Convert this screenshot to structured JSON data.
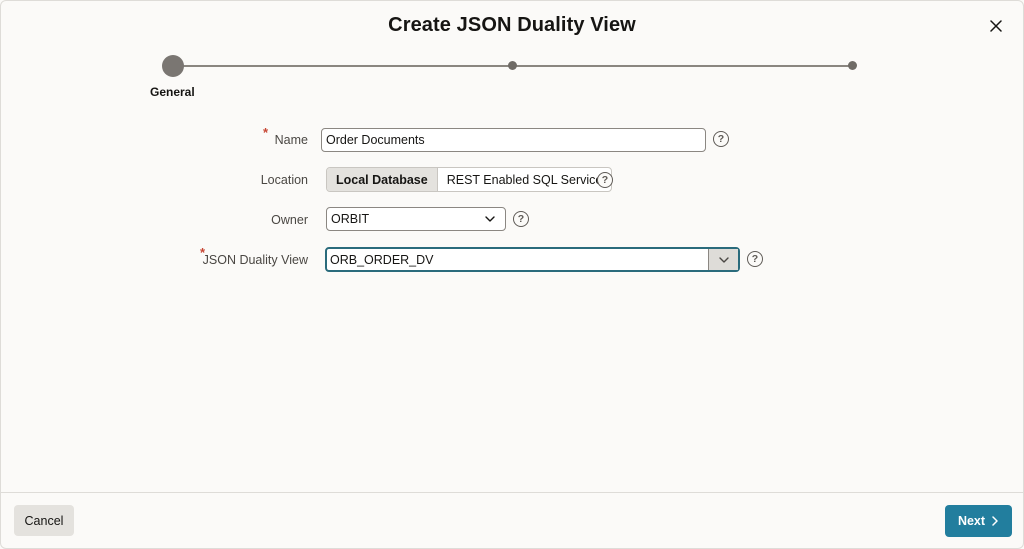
{
  "dialog": {
    "title": "Create JSON Duality View",
    "close_icon": "close-icon"
  },
  "wizard": {
    "steps": [
      {
        "label": "General",
        "state": "active"
      },
      {
        "label": "",
        "state": "pending"
      },
      {
        "label": "",
        "state": "pending"
      }
    ]
  },
  "form": {
    "name": {
      "label": "Name",
      "required": true,
      "value": "Order Documents"
    },
    "location": {
      "label": "Location",
      "options": [
        "Local Database",
        "REST Enabled SQL Service"
      ],
      "selected": "Local Database"
    },
    "owner": {
      "label": "Owner",
      "value": "ORBIT"
    },
    "duality_view": {
      "label": "JSON Duality View",
      "required": true,
      "value": "ORB_ORDER_DV"
    },
    "required_marker": "*",
    "help_glyph": "?"
  },
  "footer": {
    "cancel_label": "Cancel",
    "next_label": "Next"
  },
  "colors": {
    "primary": "#227e9e",
    "required": "#c74634",
    "focus_border": "#2a6b7c"
  }
}
